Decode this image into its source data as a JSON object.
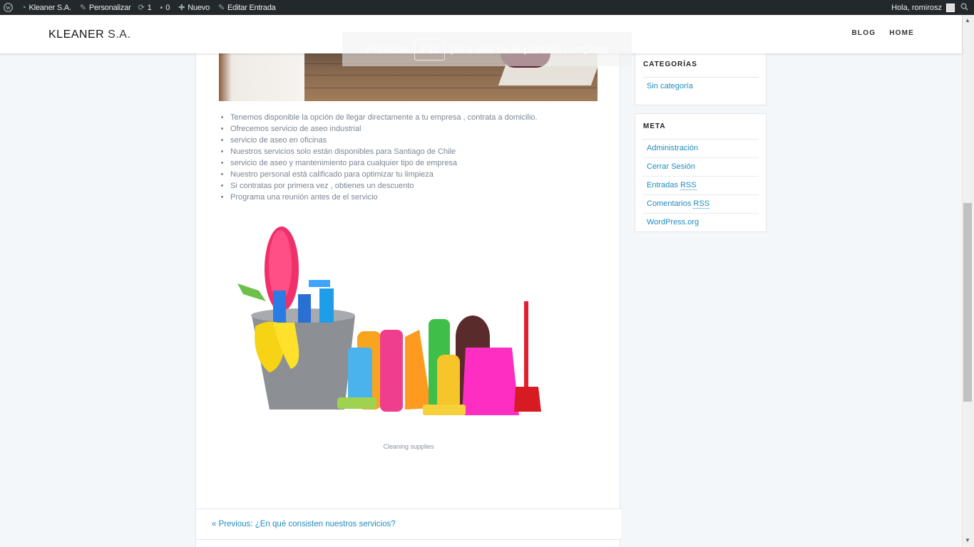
{
  "adminbar": {
    "site": "Kleaner S.A.",
    "customize": "Personalizar",
    "updates_count": "1",
    "comments_count": "0",
    "new": "Nuevo",
    "edit": "Editar Entrada",
    "greeting": "Hola, romirosz"
  },
  "header": {
    "title_bold": "KLEANER",
    "title_thin": " S.A.",
    "nav": [
      "BLOG",
      "HOME"
    ]
  },
  "fullscreen_notice": {
    "before": "Presiona",
    "key": "F11",
    "after": "para salir de la pantalla completa"
  },
  "post": {
    "bullets": [
      "Tenemos disponible la opción de llegar directamente a tu empresa , contrata a domicilio.",
      "Ofrecemos servicio de aseo industrial",
      "servicio de aseo en oficinas",
      "Nuestros servicios solo están disponibles para Santiago de Chile",
      "servicio de aseo y mantenimiento para cualquier tipo de empresa",
      "Nuestro personal está calificado para optimizar tu limpieza",
      "Si contratas por primera vez , obtienes un descuento",
      "Programa una reunión antes de el servicio"
    ],
    "image_caption": "Cleaning supplies",
    "previous_link": "Previous: ¿En qué consisten nuestros servicios?"
  },
  "sidebar": {
    "categories": {
      "title": "CATEGORÍAS",
      "items": [
        "Sin categoría"
      ]
    },
    "meta": {
      "title": "META",
      "items": [
        "Administración",
        "Cerrar Sesión",
        "Entradas",
        "Comentarios",
        "WordPress.org"
      ],
      "rss_abbr": "RSS"
    }
  },
  "colors": {
    "adminbar": "#23282d",
    "link": "#1e8cbe",
    "background": "#f3f7fa"
  }
}
